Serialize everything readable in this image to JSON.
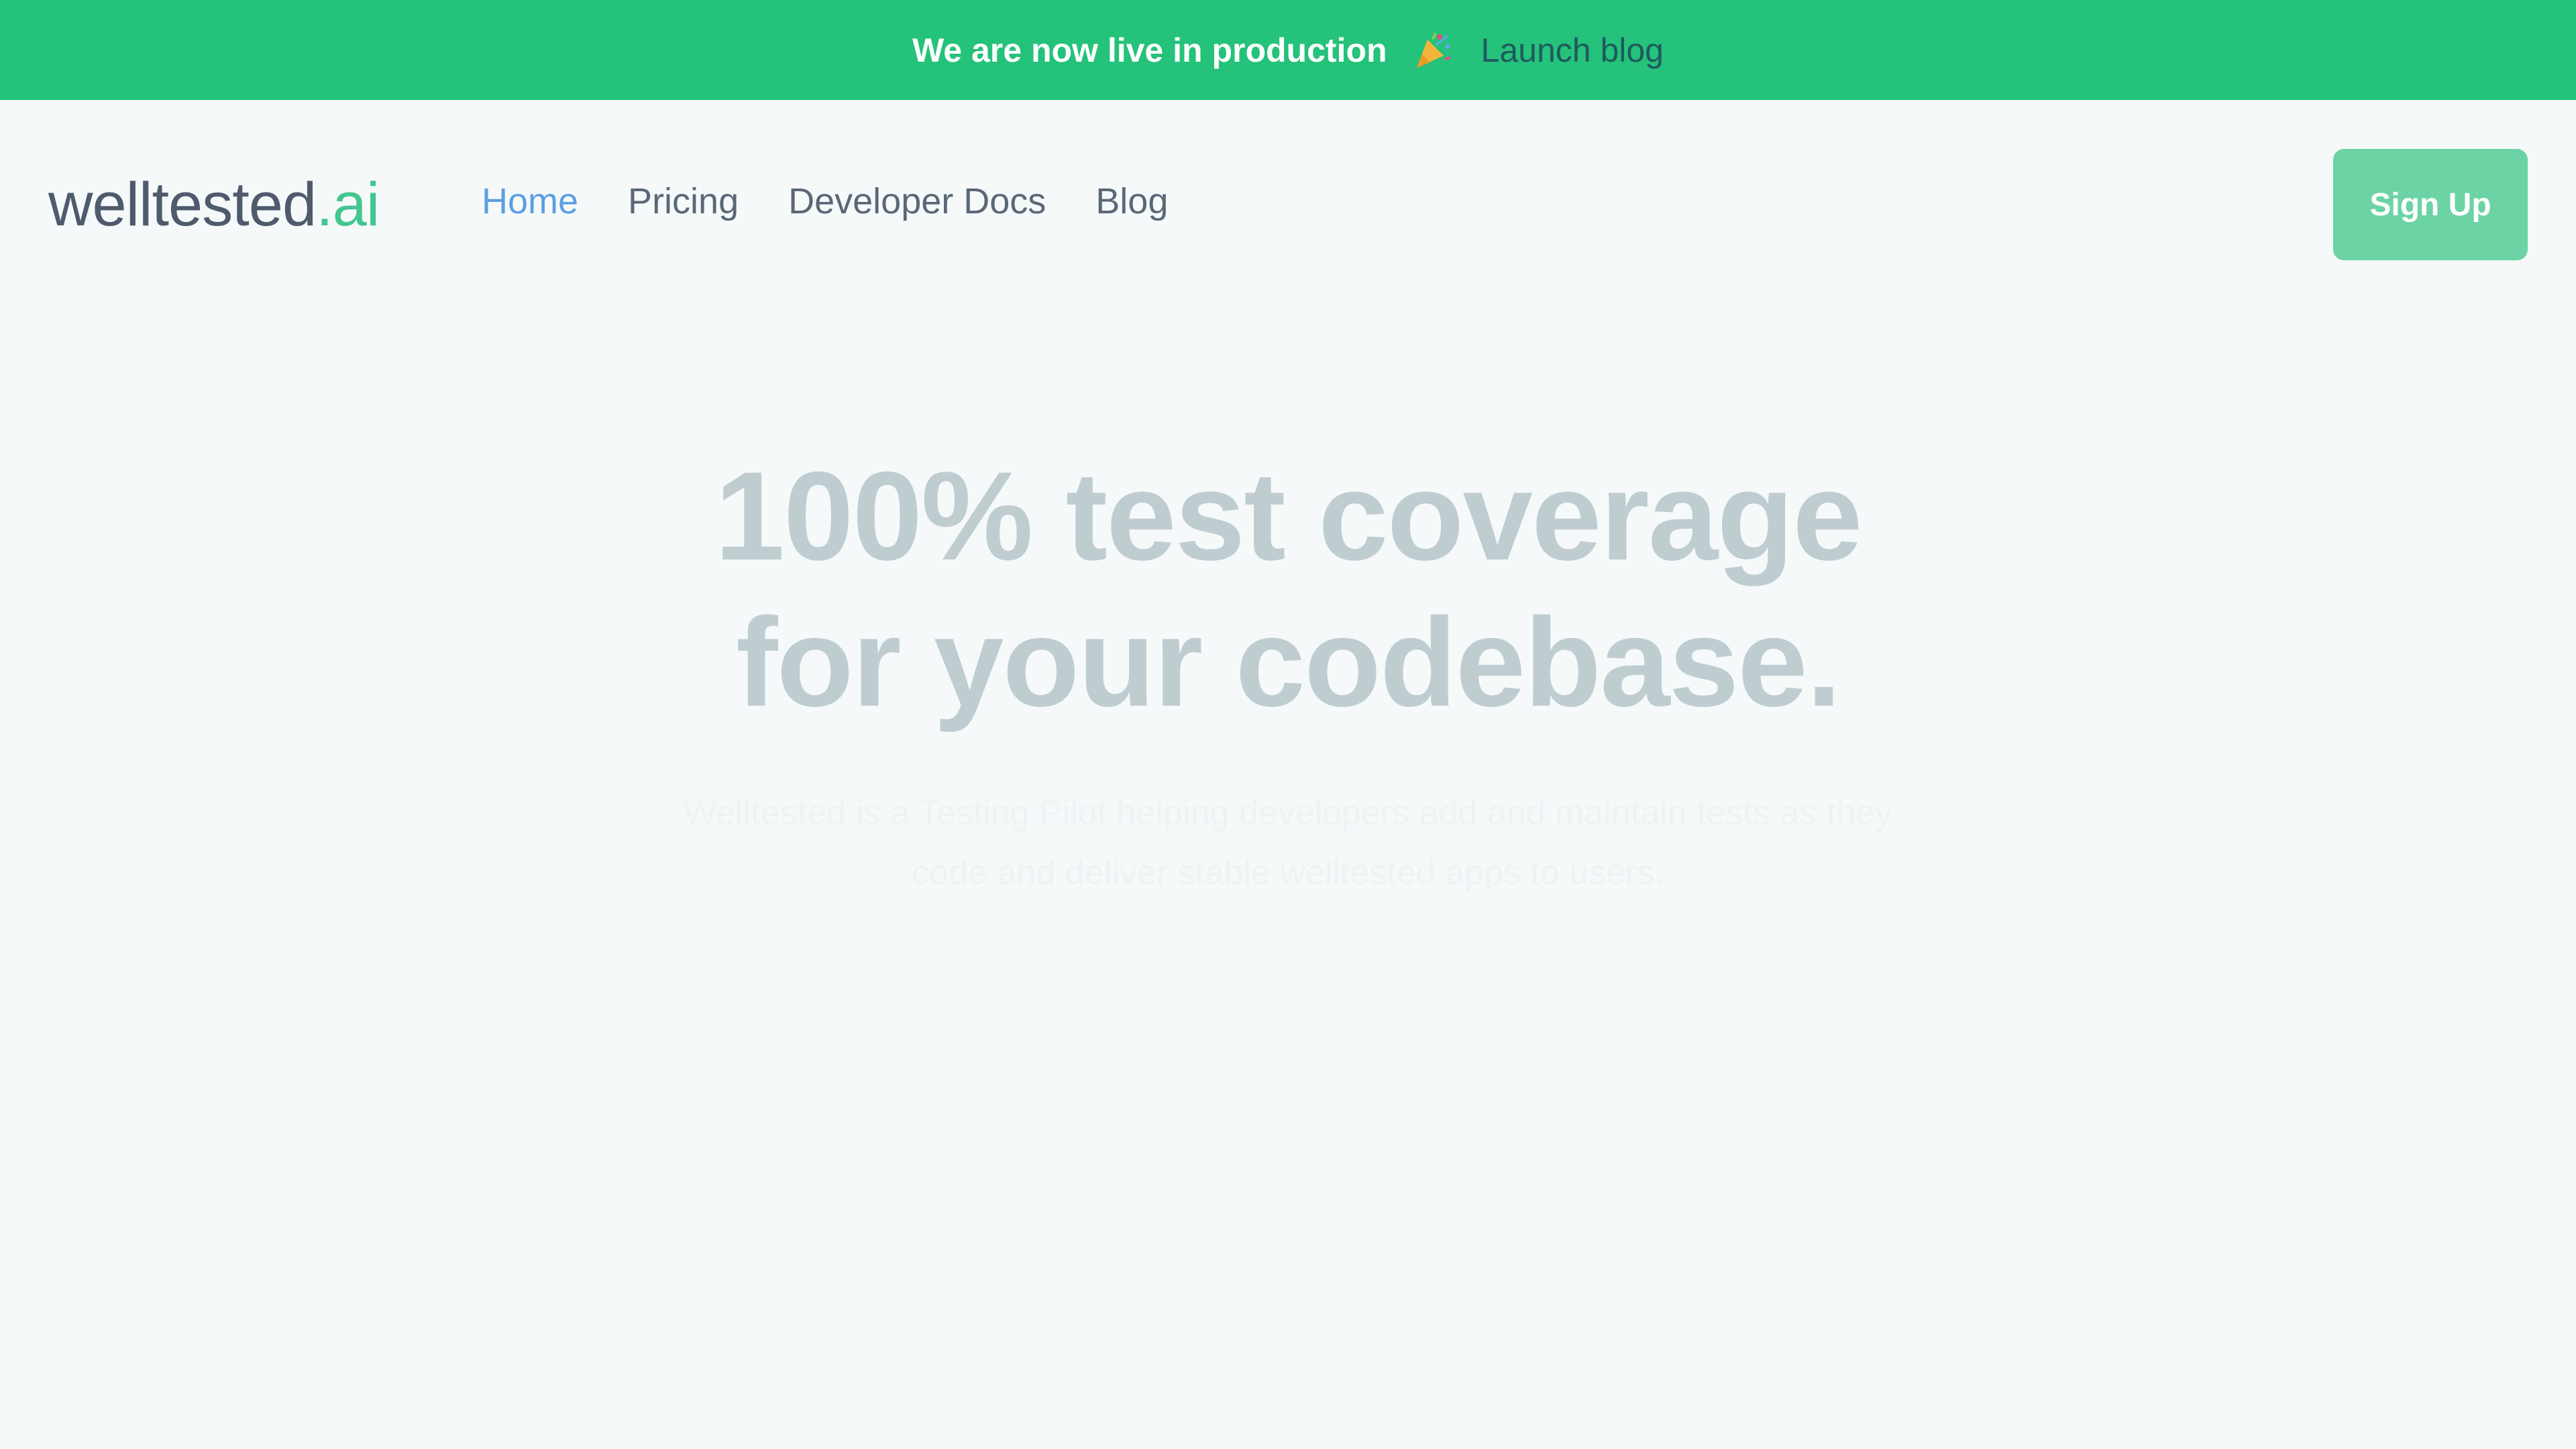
{
  "announcement": {
    "text": "We are now live in production",
    "icon": "party-popper-icon",
    "link_label": "Launch blog",
    "background": "#24c27a"
  },
  "header": {
    "logo": {
      "main": "welltested",
      "accent": ".ai"
    },
    "nav": [
      {
        "label": "Home",
        "active": true
      },
      {
        "label": "Pricing",
        "active": false
      },
      {
        "label": "Developer Docs",
        "active": false
      },
      {
        "label": "Blog",
        "active": false
      }
    ],
    "signup_label": "Sign Up"
  },
  "hero": {
    "title_line1": "100% test coverage",
    "title_line2": "for your codebase.",
    "subtitle_line1": "Welltested is a Testing Pilot helping developers add and maintain tests as they",
    "subtitle_line2": "code and deliver stable welltested apps to users."
  },
  "colors": {
    "accent": "#43c690",
    "button": "#6bd3a4",
    "active_nav": "#5c9fe0",
    "text": "#5a6876",
    "background": "#f5f9fa"
  }
}
